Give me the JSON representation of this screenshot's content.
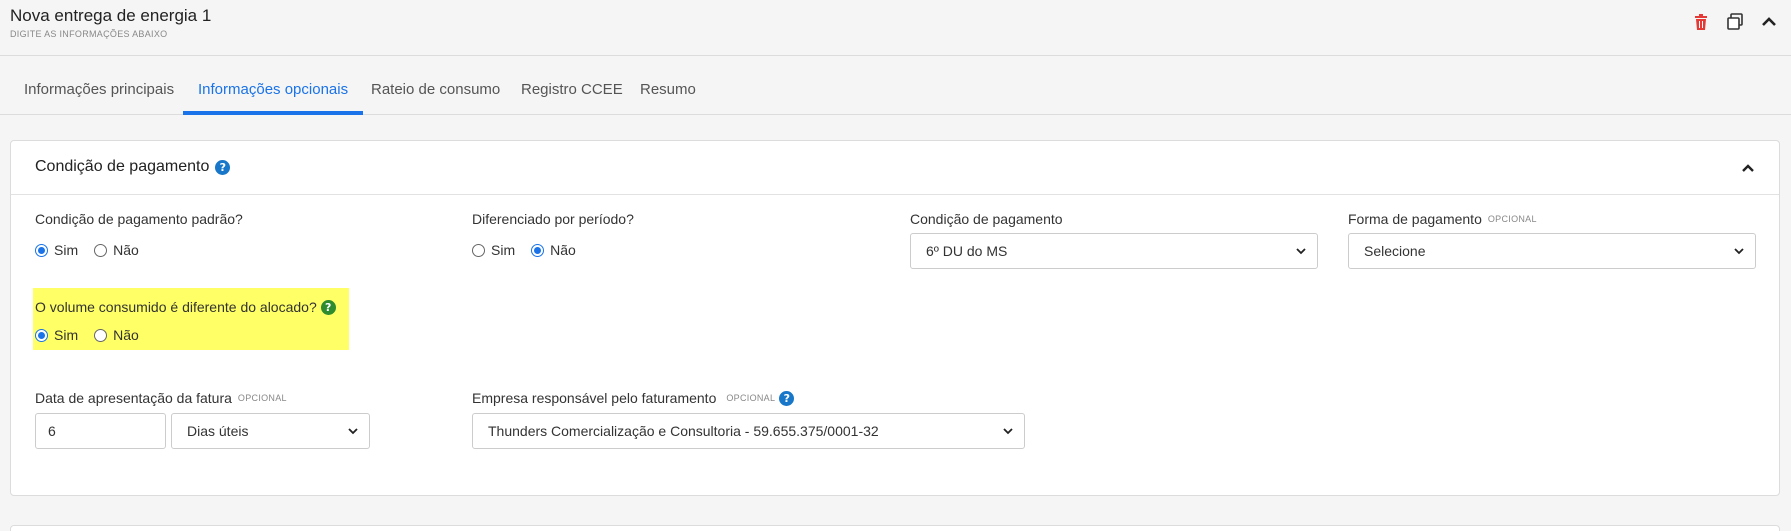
{
  "header": {
    "title": "Nova entrega de energia 1",
    "subtitle": "DIGITE AS INFORMAÇÕES ABAIXO",
    "icons": [
      "trash-icon",
      "copy-icon",
      "chevron-up-icon"
    ],
    "trash_color": "#e53935"
  },
  "tabs": [
    {
      "label": "Informações principais",
      "active": false
    },
    {
      "label": "Informações opcionais",
      "active": true
    },
    {
      "label": "Rateio de consumo",
      "active": false
    },
    {
      "label": "Registro CCEE",
      "active": false
    },
    {
      "label": "Resumo",
      "active": false
    }
  ],
  "section": {
    "title": "Condição de pagamento",
    "help_icon": "question-icon",
    "fields": {
      "padrao": {
        "label": "Condição de pagamento padrão?",
        "options": [
          "Sim",
          "Não"
        ],
        "selected": "Sim"
      },
      "diferenciado": {
        "label": "Diferenciado por período?",
        "options": [
          "Sim",
          "Não"
        ],
        "selected": "Não"
      },
      "condicao": {
        "label": "Condição de pagamento",
        "value": "6º DU do MS"
      },
      "forma": {
        "label": "Forma de pagamento",
        "optional": "OPCIONAL",
        "value": "Selecione"
      },
      "volume": {
        "label": "O volume consumido é diferente do alocado?",
        "options": [
          "Sim",
          "Não"
        ],
        "selected": "Sim",
        "highlight_color": "#ffff66"
      },
      "data_fatura": {
        "label": "Data de apresentação da fatura",
        "optional": "OPCIONAL",
        "value": "6",
        "unit": "Dias úteis"
      },
      "empresa": {
        "label": "Empresa responsável pelo faturamento",
        "optional": "OPCIONAL",
        "value": "Thunders Comercialização e Consultoria - 59.655.375/0001-32"
      }
    }
  },
  "colors": {
    "accent": "#1a73e8",
    "help_blue": "#1877c9",
    "help_green": "#2e8b2e"
  }
}
